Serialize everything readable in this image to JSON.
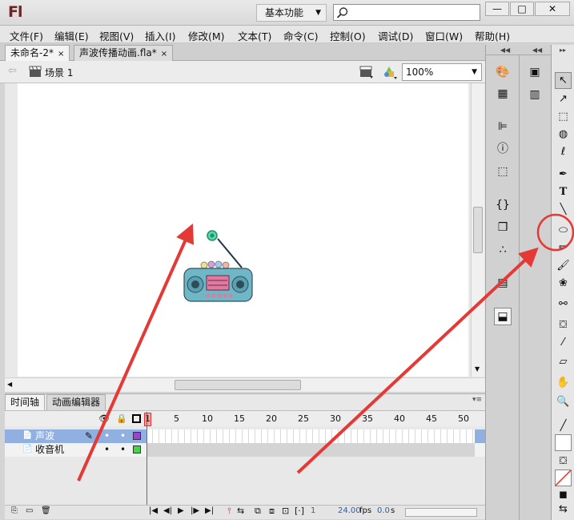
{
  "app": {
    "logo": "Fl",
    "workspace": "基本功能"
  },
  "window_buttons": [
    "—",
    "□",
    "✕"
  ],
  "menu": [
    "文件(F)",
    "编辑(E)",
    "视图(V)",
    "插入(I)",
    "修改(M)",
    "文本(T)",
    "命令(C)",
    "控制(O)",
    "调试(D)",
    "窗口(W)",
    "帮助(H)"
  ],
  "doc_tabs": [
    {
      "label": "未命名-2*",
      "close": "×"
    },
    {
      "label": "声波传播动画.fla*",
      "close": "×"
    }
  ],
  "editbar": {
    "scene": "场景 1",
    "zoom": "100%"
  },
  "timeline": {
    "tabs": [
      "时间轴",
      "动画编辑器"
    ],
    "frame_numbers": [
      "1",
      "5",
      "10",
      "15",
      "20",
      "25",
      "30",
      "35",
      "40",
      "45",
      "50"
    ],
    "layers": [
      {
        "name": "声波",
        "color": "#9b42d8",
        "selected": true
      },
      {
        "name": "收音机",
        "color": "#44d444",
        "selected": false
      }
    ],
    "status": {
      "frame": "1",
      "fps": "24.00",
      "fps_unit": "fps",
      "time": "0.0",
      "time_unit": "s"
    }
  },
  "colors": {
    "annotation_arrow": "#e53935",
    "selection": "#8fb0e0"
  },
  "icons": {
    "tools": [
      "selection-tool-icon",
      "subselection-tool-icon",
      "free-transform-tool-icon",
      "3d-rotation-tool-icon",
      "lasso-tool-icon",
      "pen-tool-icon",
      "text-tool-icon",
      "line-tool-icon",
      "oval-tool-icon",
      "pencil-tool-icon",
      "brush-tool-icon",
      "deco-tool-icon",
      "bone-tool-icon",
      "paint-bucket-tool-icon",
      "eyedropper-tool-icon",
      "eraser-tool-icon",
      "hand-tool-icon",
      "zoom-tool-icon"
    ]
  }
}
